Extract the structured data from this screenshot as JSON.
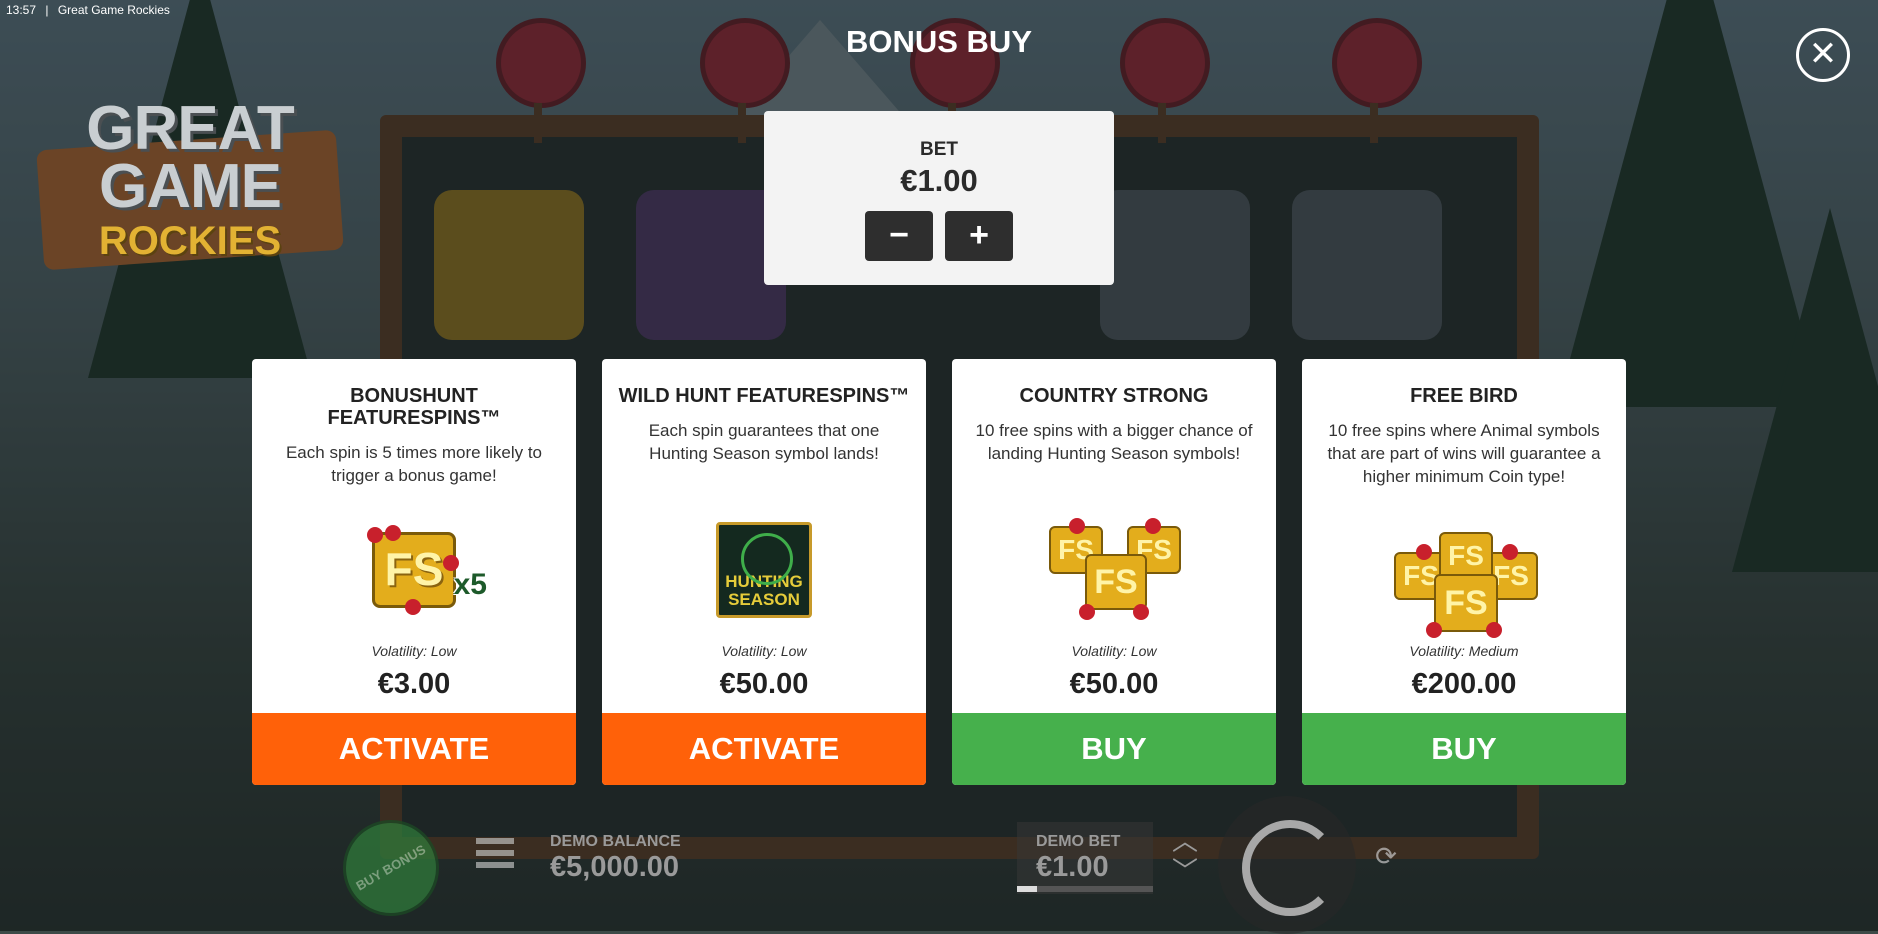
{
  "status": {
    "time": "13:57",
    "separator": "|",
    "app_title": "Great Game Rockies"
  },
  "modal": {
    "title": "BONUS BUY",
    "close_glyph": "✕"
  },
  "logo": {
    "line1": "GREAT",
    "line2": "GAME",
    "line3": "ROCKIES"
  },
  "bet": {
    "label": "BET",
    "value": "€1.00",
    "minus": "−",
    "plus": "+"
  },
  "cards": [
    {
      "title": "BONUSHUNT FEATURESPINS™",
      "description": "Each spin is 5 times more likely to trigger a bonus game!",
      "image_icon": "fs-x5-icon",
      "image_text": "FS",
      "image_badge": "x5",
      "volatility": "Volatility: Low",
      "price": "€3.00",
      "button": "ACTIVATE",
      "button_color": "#ff6109"
    },
    {
      "title": "WILD HUNT FEATURESPINS™",
      "description": "Each spin guarantees that one Hunting Season symbol lands!",
      "image_icon": "hunting-season-icon",
      "image_text": "HUNTING SEASON",
      "volatility": "Volatility: Low",
      "price": "€50.00",
      "button": "ACTIVATE",
      "button_color": "#ff6109"
    },
    {
      "title": "COUNTRY STRONG",
      "description": "10 free spins with a bigger chance of landing Hunting Season symbols!",
      "image_icon": "fs-triple-icon",
      "image_text": "FS",
      "volatility": "Volatility: Low",
      "price": "€50.00",
      "button": "BUY",
      "button_color": "#46b04c"
    },
    {
      "title": "FREE BIRD",
      "description": "10 free spins where Animal symbols that are part of wins will guarantee a higher minimum Coin type!",
      "image_icon": "fs-quad-icon",
      "image_text": "FS",
      "volatility": "Volatility: Medium",
      "price": "€200.00",
      "button": "BUY",
      "button_color": "#46b04c"
    }
  ],
  "bottom_bar": {
    "buy_bonus": "BUY BONUS",
    "demo_balance_label": "DEMO BALANCE",
    "demo_balance_value": "€5,000.00",
    "demo_bet_label": "DEMO BET",
    "demo_bet_value": "€1.00"
  }
}
